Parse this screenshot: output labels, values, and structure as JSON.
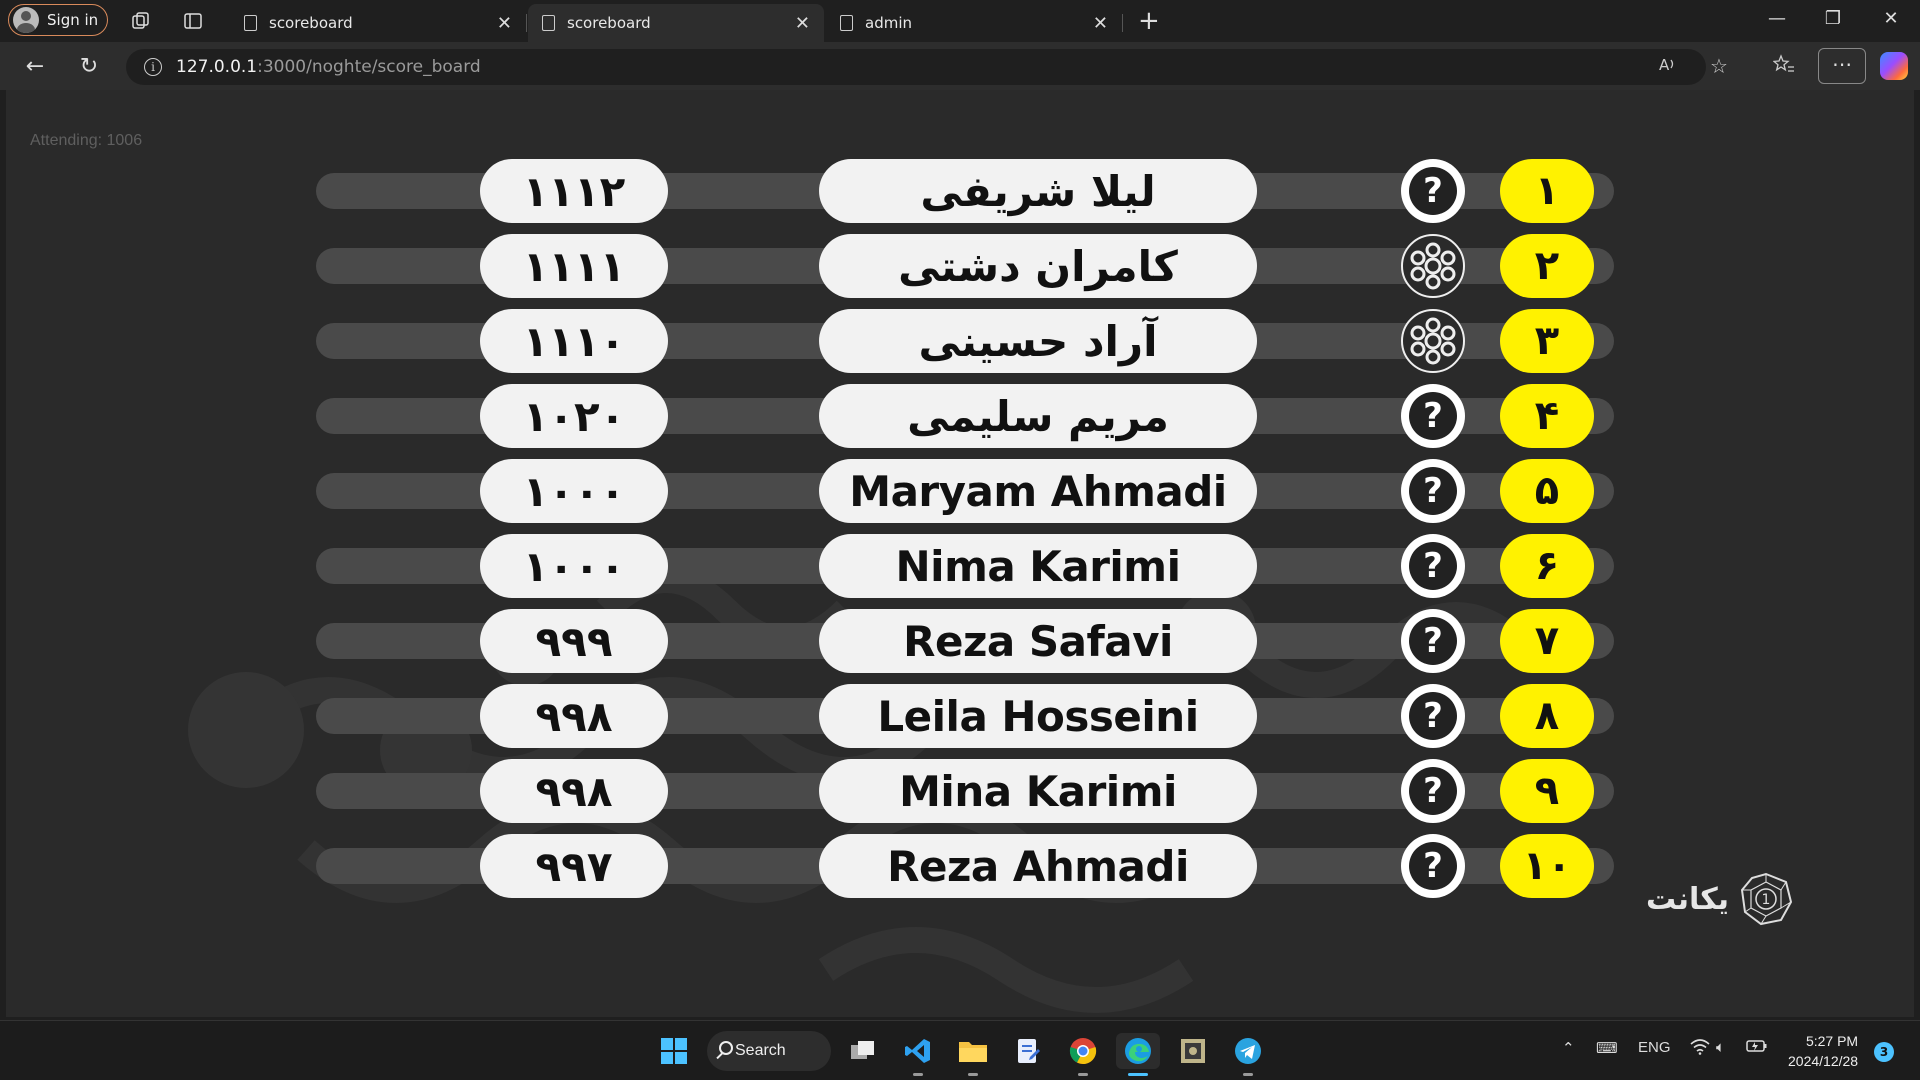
{
  "browser": {
    "signin_label": "Sign in",
    "tabs": [
      {
        "title": "scoreboard",
        "active": false
      },
      {
        "title": "scoreboard",
        "active": true
      },
      {
        "title": "admin",
        "active": false
      }
    ],
    "url_host": "127.0.0.1",
    "url_path": ":3000/noghte/score_board"
  },
  "page": {
    "attending_label": "Attending: 1006",
    "rows": [
      {
        "rank": "۱",
        "name": "لیلا شریفی",
        "score": "۱۱۱۲",
        "avatar": "question"
      },
      {
        "rank": "۲",
        "name": "کامران دشتی",
        "score": "۱۱۱۱",
        "avatar": "pattern"
      },
      {
        "rank": "۳",
        "name": "آراد حسینی",
        "score": "۱۱۱۰",
        "avatar": "pattern"
      },
      {
        "rank": "۴",
        "name": "مریم سلیمی",
        "score": "۱۰۲۰",
        "avatar": "question"
      },
      {
        "rank": "۵",
        "name": "Maryam Ahmadi",
        "score": "۱۰۰۰",
        "avatar": "question"
      },
      {
        "rank": "۶",
        "name": "Nima Karimi",
        "score": "۱۰۰۰",
        "avatar": "question"
      },
      {
        "rank": "۷",
        "name": "Reza Safavi",
        "score": "۹۹۹",
        "avatar": "question"
      },
      {
        "rank": "۸",
        "name": "Leila Hosseini",
        "score": "۹۹۸",
        "avatar": "question"
      },
      {
        "rank": "۹",
        "name": "Mina Karimi",
        "score": "۹۹۸",
        "avatar": "question"
      },
      {
        "rank": "۱۰",
        "name": "Reza Ahmadi",
        "score": "۹۹۷",
        "avatar": "question"
      }
    ],
    "avatar_placeholder": "?",
    "logo_text": "یکانت",
    "logo_mark": "1",
    "colors": {
      "rank_bg": "#fff200",
      "pill_bg": "#f2f2f2",
      "track": "#4a4a4a",
      "page_bg": "#2a2a2a"
    }
  },
  "taskbar": {
    "search_label": "Search",
    "lang": "ENG",
    "time": "5:27 PM",
    "date": "2024/12/28",
    "notifications": "3"
  }
}
